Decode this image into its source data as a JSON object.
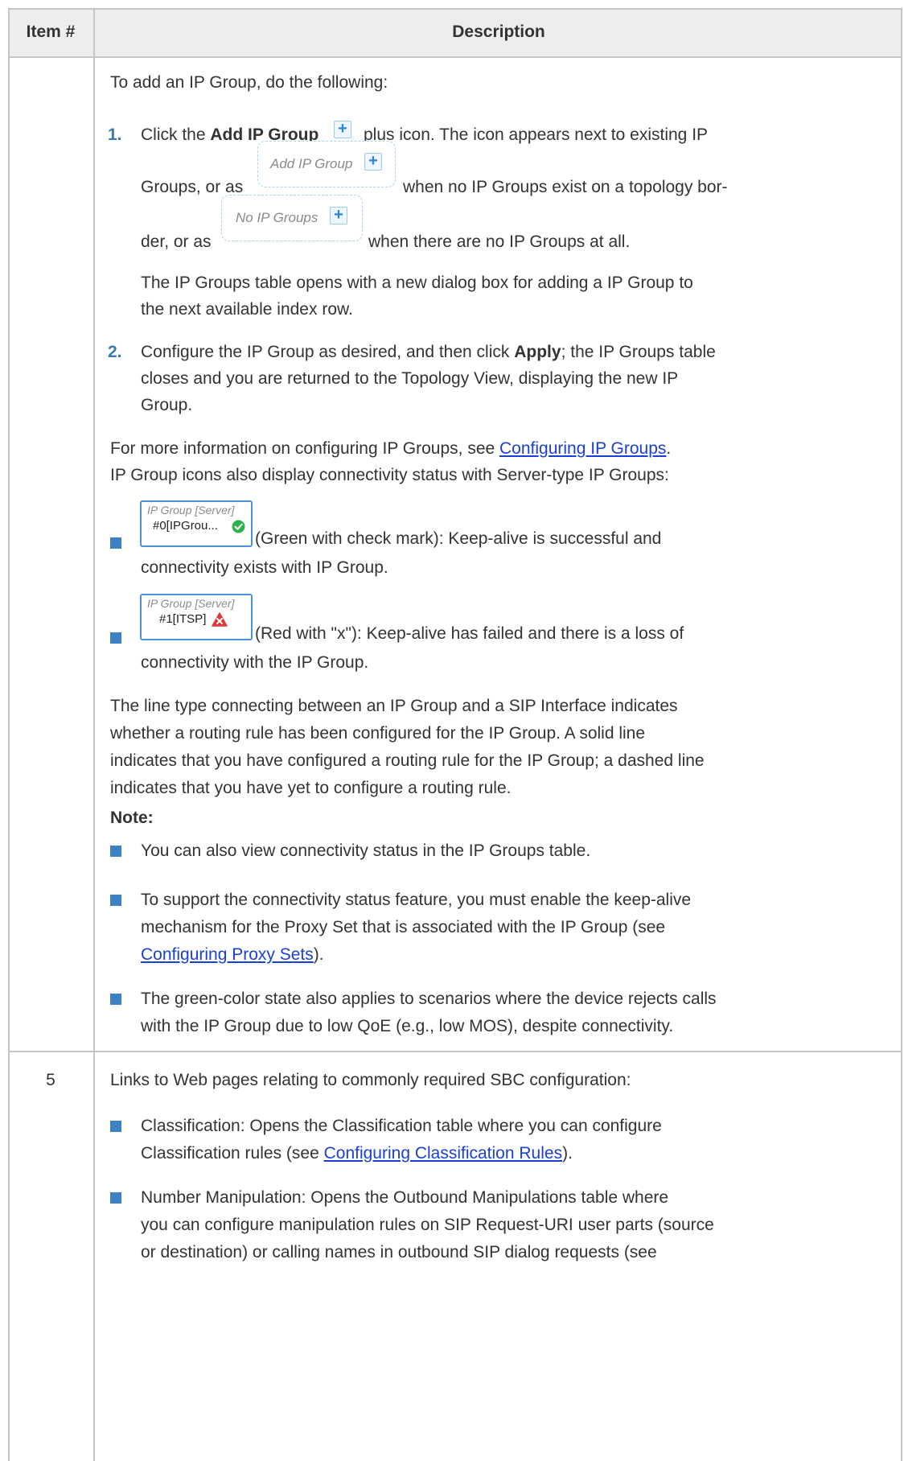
{
  "header": {
    "col_item": "Item #",
    "col_desc": "Description"
  },
  "row_a": {
    "intro": "To add an IP Group, do the following:",
    "step1": {
      "num": "1.",
      "pre": "Click the ",
      "bold": "Add IP Group",
      "post": "plus icon. The icon appears next to existing IP",
      "l2_pre": "Groups, or as",
      "l2_post": "when no IP Groups exist on a topology bor-",
      "l3_pre": "der, or as",
      "l3_post": "when there are no IP Groups at all.",
      "add_badge_label": "Add IP Group",
      "none_badge_label": "No IP Groups",
      "plus_glyph": "+"
    },
    "step1_note": [
      "The IP Groups table opens with a new dialog box for adding a IP Group to",
      "the next available index row."
    ],
    "step2": {
      "num": "2.",
      "pre": "Configure the IP Group as desired, and then click ",
      "bold": "Apply",
      "post": "; the IP Groups table",
      "line2": "closes and you are returned to the Topology View, displaying the new IP",
      "line3": "Group."
    },
    "more_pre": "For more information on configuring IP Groups, see ",
    "more_link": "Configuring IP Groups",
    "more_post": ".",
    "status_intro": "IP Group icons also display connectivity status with Server-type IP Groups:",
    "status_green": {
      "badge_title": "IP Group [Server]",
      "badge_name": "#0[IPGrou...",
      "text1": "(Green with check mark): Keep-alive is successful and",
      "text2": "connectivity exists with IP Group."
    },
    "status_red": {
      "badge_title": "IP Group [Server]",
      "badge_name": "#1[ITSP]",
      "text1": "(Red with \"x\"): Keep-alive has failed and there is a loss of",
      "text2": "connectivity with the IP Group."
    },
    "line_type": [
      "The line type connecting between an IP Group and a SIP Interface indicates",
      "whether a routing rule has been configured for the IP Group. A solid line",
      "indicates that you have configured a routing rule for the IP Group; a dashed line",
      "indicates that you have yet to configure a routing rule."
    ],
    "note_label": "Note:",
    "note1": "You can also view connectivity status in the IP Groups table.",
    "note2": {
      "line1": "To support the connectivity status feature, you must enable the keep-alive",
      "line2": "mechanism for the Proxy Set that is associated with the IP Group (see",
      "link": "Configuring Proxy Sets",
      "post": ")."
    },
    "note3": [
      "The green-color state also applies to scenarios where the device rejects calls",
      "with the IP Group due to low QoE (e.g., low MOS), despite connectivity."
    ]
  },
  "row_b": {
    "item": "5",
    "intro": "Links to Web pages relating to commonly required SBC configuration:",
    "classification": {
      "line1": "Classification: Opens the Classification table where you can configure",
      "line2_pre": "Classification rules (see ",
      "link": "Configuring Classification Rules",
      "line2_post": ")."
    },
    "number_manipulation": [
      "Number Manipulation: Opens the Outbound Manipulations table where",
      "you can configure manipulation rules on SIP Request-URI user parts (source",
      "or destination) or calling names in outbound SIP dialog requests (see"
    ]
  },
  "colors": {
    "bullet": "#3d80c4",
    "step_number": "#3a78b5",
    "link": "#1a3fd8",
    "header_bg": "#ededed",
    "check_green": "#2bb24c",
    "alert_red": "#e0383a"
  }
}
